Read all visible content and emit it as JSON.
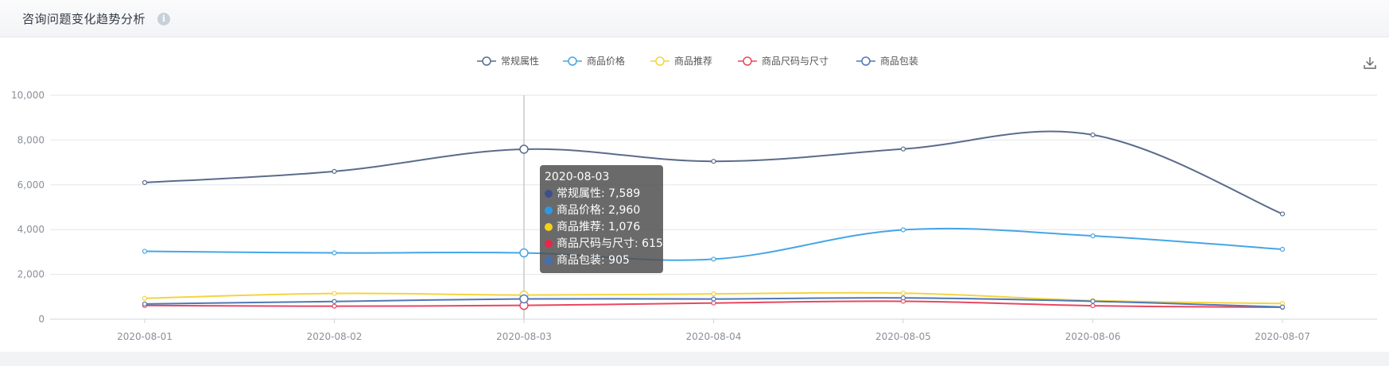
{
  "header": {
    "title": "咨询问题变化趋势分析",
    "info_icon": "i"
  },
  "chart_data": {
    "type": "line",
    "smooth": true,
    "categories": [
      "2020-08-01",
      "2020-08-02",
      "2020-08-03",
      "2020-08-04",
      "2020-08-05",
      "2020-08-06",
      "2020-08-07"
    ],
    "ylim": [
      0,
      10000
    ],
    "yticks": [
      0,
      2000,
      4000,
      6000,
      8000,
      10000
    ],
    "ytick_labels": [
      "0",
      "2,000",
      "4,000",
      "6,000",
      "8,000",
      "10,000"
    ],
    "grid": true,
    "legend_position": "top-center",
    "series": [
      {
        "name": "常规属性",
        "color": "#5b6b8c",
        "values": [
          6100,
          6600,
          7589,
          7050,
          7600,
          8230,
          4700
        ]
      },
      {
        "name": "商品价格",
        "color": "#45a6e6",
        "values": [
          3030,
          2960,
          2960,
          2680,
          3990,
          3720,
          3120
        ]
      },
      {
        "name": "商品推荐",
        "color": "#f5d43f",
        "values": [
          930,
          1150,
          1076,
          1130,
          1160,
          830,
          700
        ]
      },
      {
        "name": "商品尺码与尺寸",
        "color": "#e8475f",
        "values": [
          610,
          580,
          615,
          720,
          800,
          600,
          530
        ]
      },
      {
        "name": "商品包装",
        "color": "#4f78b6",
        "values": [
          680,
          790,
          905,
          900,
          950,
          800,
          540
        ]
      }
    ],
    "tooltip": {
      "category": "2020-08-03",
      "rows": [
        {
          "label": "常规属性: 7,589",
          "color": "#3f4f8a"
        },
        {
          "label": "商品价格: 2,960",
          "color": "#2b9ae6"
        },
        {
          "label": "商品推荐: 1,076",
          "color": "#f5d11a"
        },
        {
          "label": "商品尺码与尺寸: 615",
          "color": "#e8264a"
        },
        {
          "label": "商品包装: 905",
          "color": "#3f6fb8"
        }
      ]
    }
  },
  "toolbar": {
    "download_icon": "download-icon"
  }
}
